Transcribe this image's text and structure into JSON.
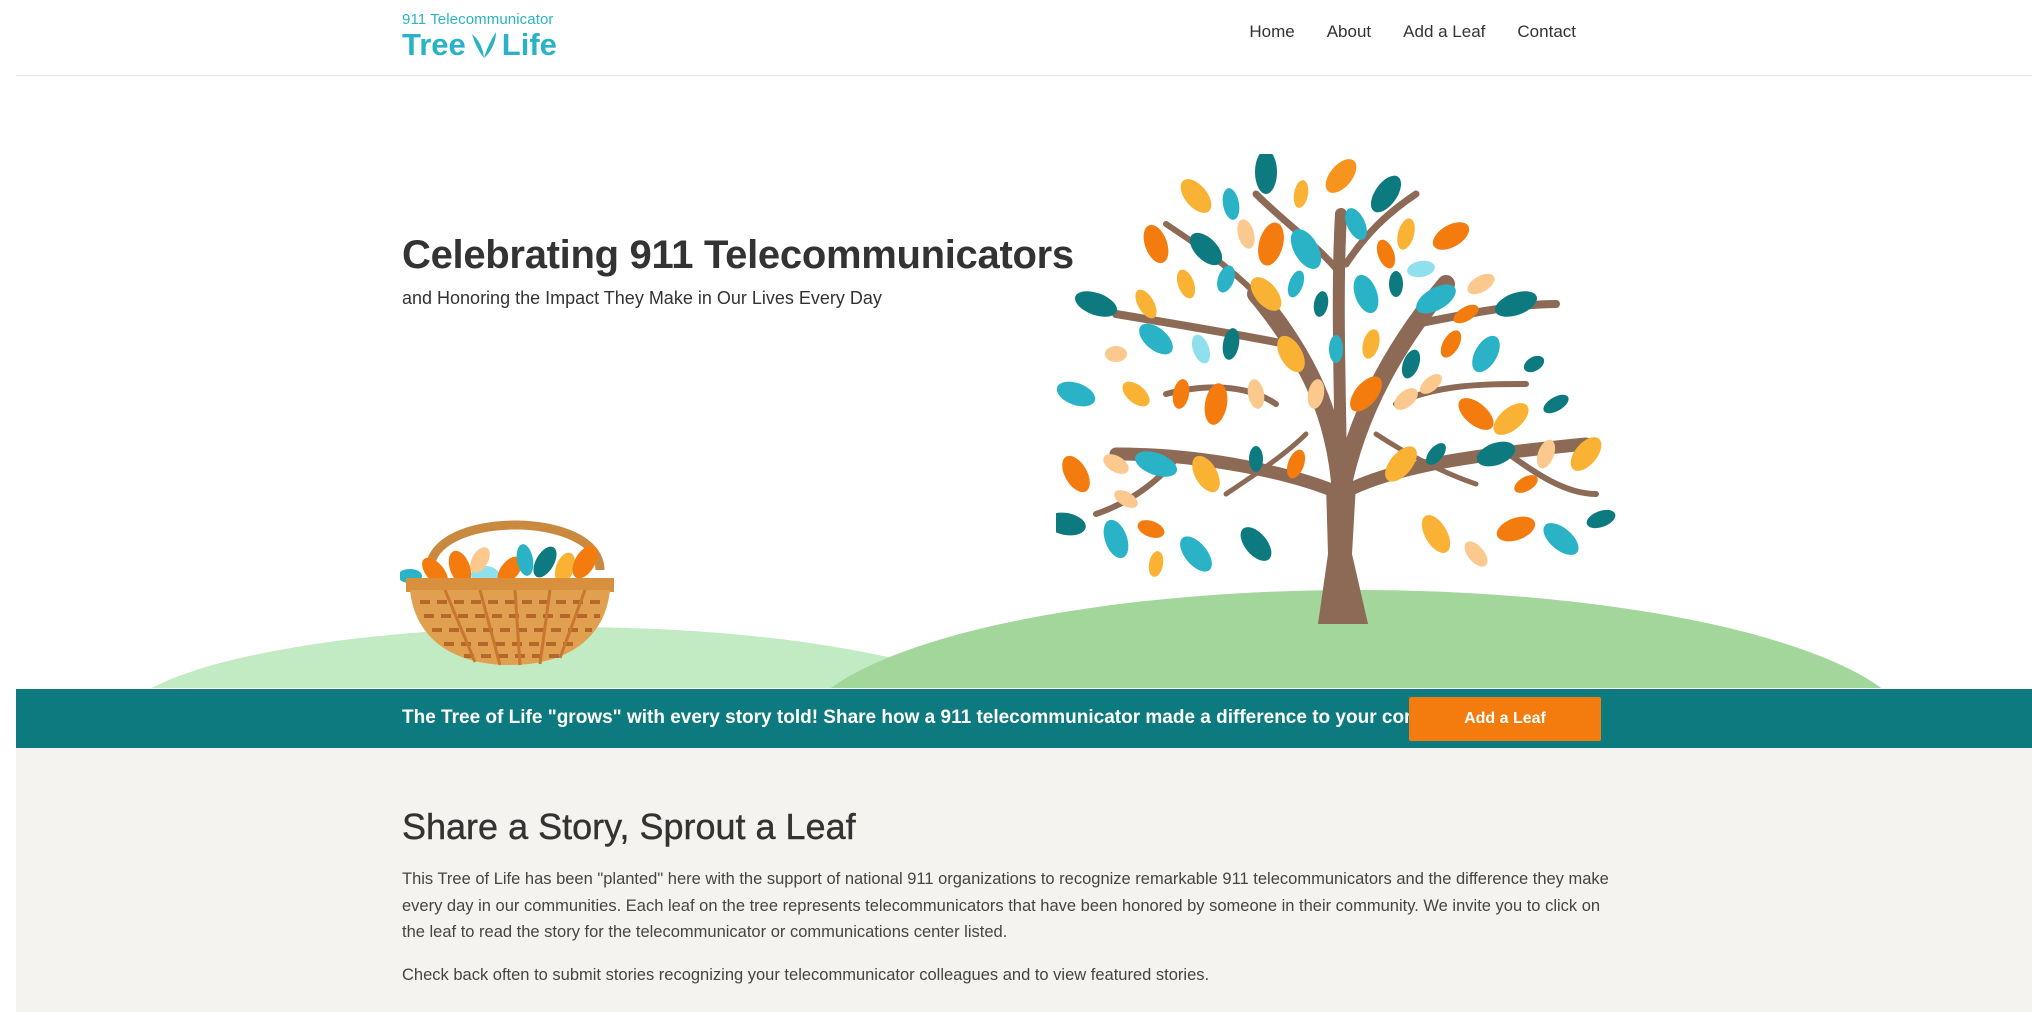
{
  "header": {
    "logo_top": "911 Telecommunicator",
    "logo_left": "Tree",
    "logo_right": "Life",
    "nav": [
      "Home",
      "About",
      "Add a Leaf",
      "Contact"
    ]
  },
  "hero": {
    "title": "Celebrating 911 Telecommunicators",
    "subtitle": "and Honoring the Impact They Make in Our Lives Every Day"
  },
  "banner": {
    "text": "The Tree of Life \"grows\" with every story told! Share how a 911 telecommunicator made a difference to your community.",
    "button": "Add a Leaf"
  },
  "content": {
    "title": "Share a Story, Sprout a Leaf",
    "paragraph1": "This Tree of Life has been \"planted\" here with the support of national 911 organizations to recognize remarkable 911 telecommunicators and the difference they make every day in our communities. Each leaf on the tree represents telecommunicators that have been honored by someone in their community. We invite you to click on the leaf to read the story for the telecommunicator or communications center listed.",
    "paragraph2": "Check back often to submit stories recognizing your telecommunicator colleagues and to view featured stories."
  },
  "colors": {
    "teal": "#0d7a80",
    "orange": "#f47b0e",
    "logo": "#2ab3c6",
    "hill_light": "#c3ebc3",
    "hill_dark": "#a2d69b",
    "trunk": "#8c6a56"
  },
  "icons": [
    "tree-logo-leaf-icon",
    "tree-illustration",
    "leaf-basket-illustration"
  ]
}
